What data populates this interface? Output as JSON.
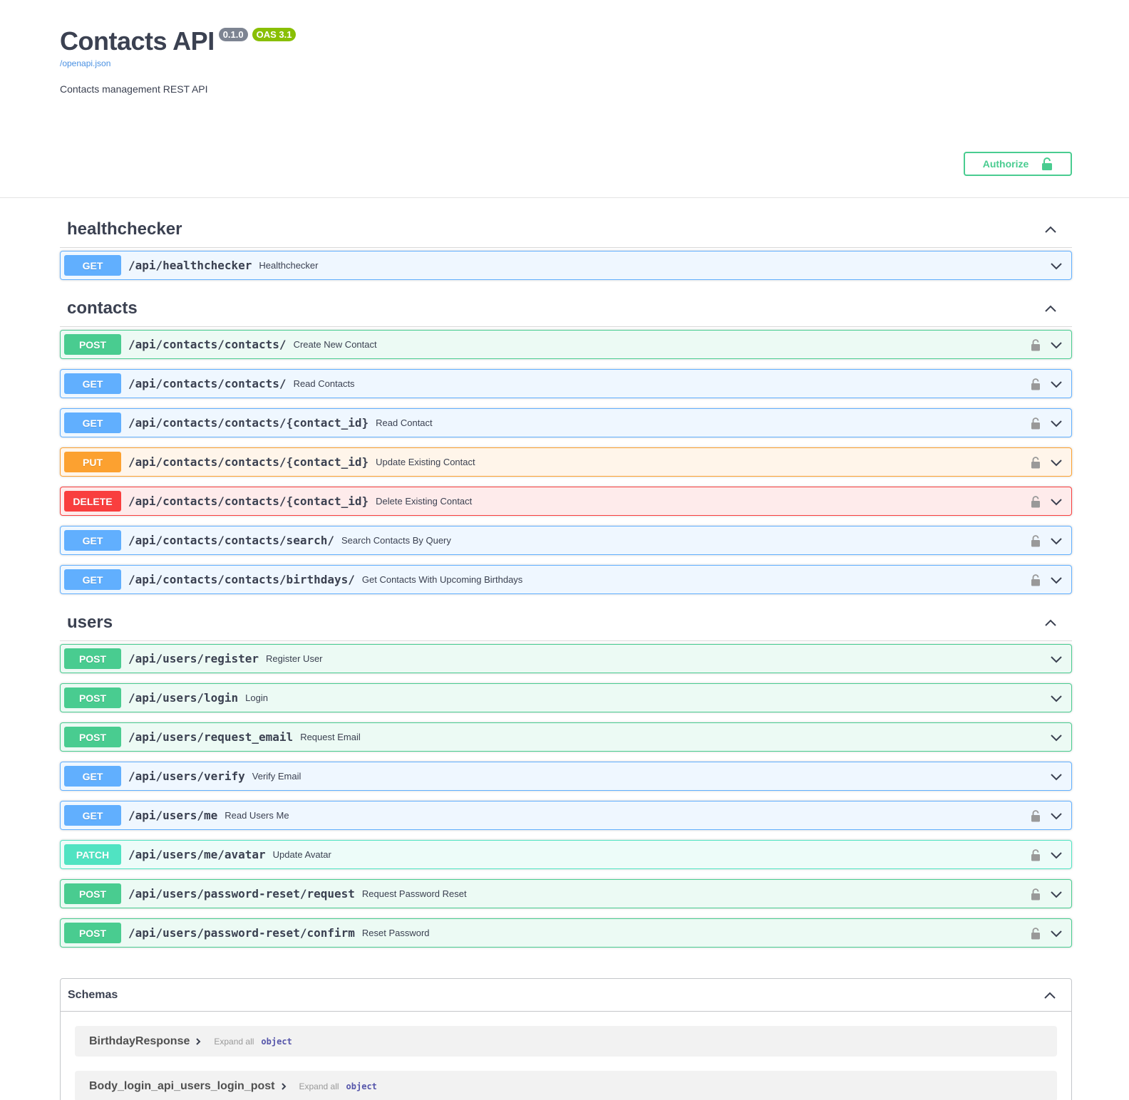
{
  "info": {
    "title": "Contacts API",
    "version": "0.1.0",
    "oas": "OAS 3.1",
    "spec_link": "/openapi.json",
    "description": "Contacts management REST API"
  },
  "authorize": {
    "label": "Authorize"
  },
  "tags": [
    {
      "name": "healthchecker",
      "operations": [
        {
          "method": "GET",
          "path": "/api/healthchecker",
          "summary": "Healthchecker",
          "locked": false
        }
      ]
    },
    {
      "name": "contacts",
      "operations": [
        {
          "method": "POST",
          "path": "/api/contacts/contacts/",
          "summary": "Create New Contact",
          "locked": true
        },
        {
          "method": "GET",
          "path": "/api/contacts/contacts/",
          "summary": "Read Contacts",
          "locked": true
        },
        {
          "method": "GET",
          "path": "/api/contacts/contacts/{contact_id}",
          "summary": "Read Contact",
          "locked": true
        },
        {
          "method": "PUT",
          "path": "/api/contacts/contacts/{contact_id}",
          "summary": "Update Existing Contact",
          "locked": true
        },
        {
          "method": "DELETE",
          "path": "/api/contacts/contacts/{contact_id}",
          "summary": "Delete Existing Contact",
          "locked": true
        },
        {
          "method": "GET",
          "path": "/api/contacts/contacts/search/",
          "summary": "Search Contacts By Query",
          "locked": true
        },
        {
          "method": "GET",
          "path": "/api/contacts/contacts/birthdays/",
          "summary": "Get Contacts With Upcoming Birthdays",
          "locked": true
        }
      ]
    },
    {
      "name": "users",
      "operations": [
        {
          "method": "POST",
          "path": "/api/users/register",
          "summary": "Register User",
          "locked": false
        },
        {
          "method": "POST",
          "path": "/api/users/login",
          "summary": "Login",
          "locked": false
        },
        {
          "method": "POST",
          "path": "/api/users/request_email",
          "summary": "Request Email",
          "locked": false
        },
        {
          "method": "GET",
          "path": "/api/users/verify",
          "summary": "Verify Email",
          "locked": false
        },
        {
          "method": "GET",
          "path": "/api/users/me",
          "summary": "Read Users Me",
          "locked": true
        },
        {
          "method": "PATCH",
          "path": "/api/users/me/avatar",
          "summary": "Update Avatar",
          "locked": true
        },
        {
          "method": "POST",
          "path": "/api/users/password-reset/request",
          "summary": "Request Password Reset",
          "locked": true
        },
        {
          "method": "POST",
          "path": "/api/users/password-reset/confirm",
          "summary": "Reset Password",
          "locked": true
        }
      ]
    }
  ],
  "schemas": {
    "title": "Schemas",
    "models": [
      {
        "name": "BirthdayResponse",
        "expand_label": "Expand all",
        "type": "object"
      },
      {
        "name": "Body_login_api_users_login_post",
        "expand_label": "Expand all",
        "type": "object"
      }
    ]
  },
  "colors": {
    "get": "#61affe",
    "post": "#49cc90",
    "put": "#fca130",
    "delete": "#f93e3e",
    "patch": "#50e3c2",
    "text": "#3b4151"
  }
}
